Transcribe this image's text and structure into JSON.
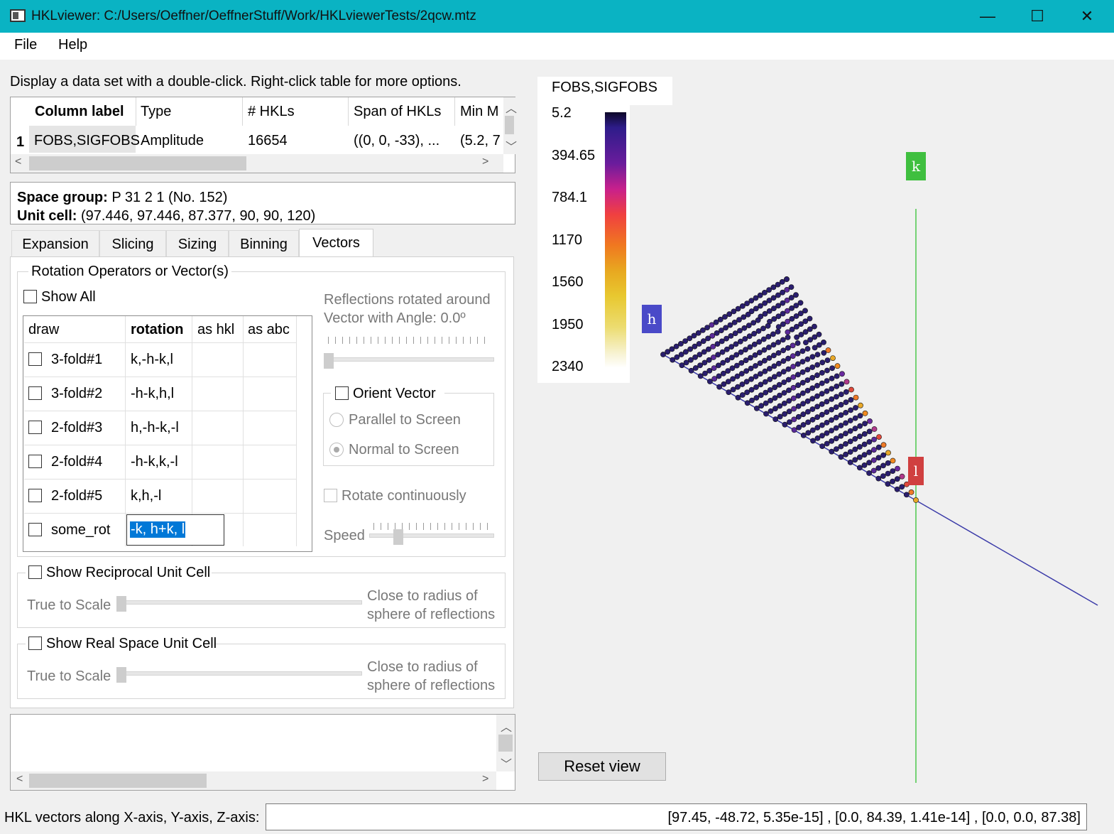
{
  "window": {
    "title": "HKLviewer: C:/Users/Oeffner/OeffnerStuff/Work/HKLviewerTests/2qcw.mtz",
    "minimize_glyph": "—",
    "maximize_glyph": "☐",
    "close_glyph": "✕"
  },
  "menu": {
    "file": "File",
    "help": "Help"
  },
  "instructions": "Display a data set with a double-click. Right-click table for more options.",
  "dataset_table": {
    "headers": [
      "Column label",
      "Type",
      "# HKLs",
      "Span of HKLs",
      "Min M"
    ],
    "row_index": "1",
    "row": [
      "FOBS,SIGFOBS",
      "Amplitude",
      "16654",
      "((0, 0, -33), ...",
      "(5.2, 7"
    ]
  },
  "crystal_info": {
    "space_group_label": "Space group:",
    "space_group_value": "P 31 2 1 (No. 152)",
    "unit_cell_label": "Unit cell:",
    "unit_cell_value": "(97.446, 97.446, 87.377, 90, 90, 120)"
  },
  "tabs": [
    "Expansion",
    "Slicing",
    "Sizing",
    "Binning",
    "Vectors"
  ],
  "vectors_tab": {
    "group_title": "Rotation Operators or Vector(s)",
    "show_all": "Show All",
    "rotation_table": {
      "headers": [
        "draw",
        "rotation",
        "as hkl",
        "as abc"
      ],
      "rows": [
        {
          "name": "3-fold#1",
          "rotation": "k,-h-k,l"
        },
        {
          "name": "3-fold#2",
          "rotation": "-h-k,h,l"
        },
        {
          "name": "2-fold#3",
          "rotation": "h,-h-k,-l"
        },
        {
          "name": "2-fold#4",
          "rotation": "-h-k,k,-l"
        },
        {
          "name": "2-fold#5",
          "rotation": "k,h,-l"
        },
        {
          "name": "some_rot",
          "rotation": "-k, h+k, l"
        }
      ]
    },
    "reflections_rotated_line1": "Reflections rotated around",
    "reflections_rotated_line2": "Vector with Angle: 0.0º",
    "orient_vector": "Orient Vector",
    "parallel_to_screen": "Parallel to Screen",
    "normal_to_screen": "Normal to Screen",
    "rotate_continuously": "Rotate continuously",
    "speed": "Speed",
    "reciprocal_cell": {
      "title": "Show Reciprocal Unit Cell",
      "true_to_scale": "True to Scale",
      "close_line1": "Close to radius of",
      "close_line2": "sphere of reflections"
    },
    "real_cell": {
      "title": "Show Real Space Unit Cell",
      "true_to_scale": "True to Scale",
      "close_line1": "Close to radius of",
      "close_line2": "sphere of reflections"
    }
  },
  "colorbar": {
    "title": "FOBS,SIGFOBS",
    "ticks": [
      "5.2",
      "394.65",
      "784.1",
      "1170",
      "1560",
      "1950",
      "2340"
    ]
  },
  "axes": {
    "h": "h",
    "k": "k",
    "l": "l",
    "h_color": "#4a4ac8",
    "k_color": "#3fbf3f",
    "l_color": "#d04040"
  },
  "reset_view": "Reset view",
  "status": {
    "label": "HKL vectors along X-axis, Y-axis, Z-axis:",
    "value": "[97.45, -48.72, 5.35e-15] , [0.0, 84.39, 1.41e-14] , [0.0, 0.0, 87.38]"
  },
  "colors": {
    "titlebar": "#0ab3c3",
    "selection": "#0078d7"
  }
}
